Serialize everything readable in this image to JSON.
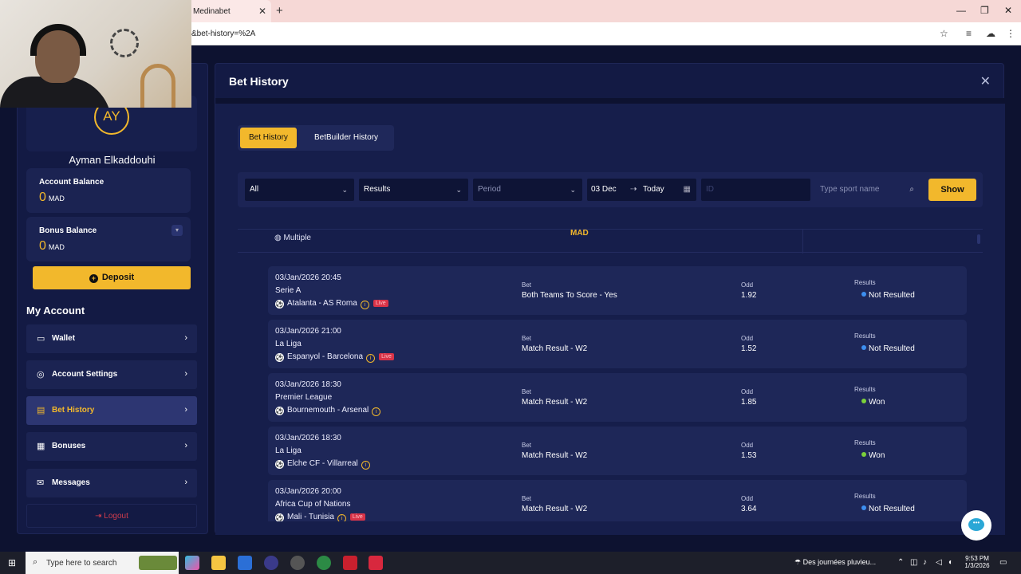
{
  "browser": {
    "tab_title": "Medinabet",
    "tab_close": "✕",
    "new_tab": "+",
    "url": "&bet-history=%2A"
  },
  "sidebar": {
    "avatar_initials": "AY",
    "user_name": "Ayman Elkaddouhi",
    "account_balance": {
      "label": "Account Balance",
      "value": "0",
      "currency": "MAD"
    },
    "bonus_balance": {
      "label": "Bonus Balance",
      "value": "0",
      "currency": "MAD"
    },
    "deposit_label": "Deposit",
    "section_title": "My Account",
    "menu": [
      {
        "label": "Wallet",
        "icon": "wallet-icon"
      },
      {
        "label": "Account Settings",
        "icon": "user-settings-icon"
      },
      {
        "label": "Bet History",
        "icon": "receipt-icon",
        "active": true
      },
      {
        "label": "Bonuses",
        "icon": "gift-icon"
      },
      {
        "label": "Messages",
        "icon": "messages-icon"
      }
    ],
    "logout_label": "Logout"
  },
  "panel": {
    "title": "Bet History",
    "tabs": [
      "Bet History",
      "BetBuilder History"
    ],
    "filters": {
      "type": "All",
      "status": "Results",
      "period_placeholder": "Period",
      "date_from": "03 Dec",
      "date_to": "Today",
      "id_placeholder": "ID",
      "sport_placeholder": "Type sport name",
      "show_label": "Show"
    },
    "header": {
      "type": "Multiple",
      "currency": "MAD"
    },
    "bet_col_label": "Bet",
    "odd_col_label": "Odd",
    "results_col_label": "Results",
    "live_label": "Live",
    "bets": [
      {
        "datetime": "03/Jan/2026 20:45",
        "league": "Serie A",
        "match": "Atalanta - AS Roma",
        "live": true,
        "bet": "Both Teams To Score - Yes",
        "odd": "1.92",
        "result": "Not Resulted"
      },
      {
        "datetime": "03/Jan/2026 21:00",
        "league": "La Liga",
        "match": "Espanyol - Barcelona",
        "live": true,
        "bet": "Match Result - W2",
        "odd": "1.52",
        "result": "Not Resulted"
      },
      {
        "datetime": "03/Jan/2026 18:30",
        "league": "Premier League",
        "match": "Bournemouth - Arsenal",
        "live": false,
        "bet": "Match Result - W2",
        "odd": "1.85",
        "result": "Won"
      },
      {
        "datetime": "03/Jan/2026 18:30",
        "league": "La Liga",
        "match": "Elche CF - Villarreal",
        "live": false,
        "bet": "Match Result - W2",
        "odd": "1.53",
        "result": "Won"
      },
      {
        "datetime": "03/Jan/2026 20:00",
        "league": "Africa Cup of Nations",
        "match": "Mali - Tunisia",
        "live": true,
        "bet": "Match Result - W2",
        "odd": "3.64",
        "result": "Not Resulted"
      }
    ]
  },
  "colors": {
    "accent": "#f2b82c",
    "not_resulted": "#3d8ff0",
    "won": "#7bd13a",
    "live": "#d83348"
  },
  "taskbar": {
    "search_placeholder": "Type here to search",
    "weather_text": "Des journées pluvieu...",
    "time": "9:53 PM",
    "date": "1/3/2026"
  }
}
